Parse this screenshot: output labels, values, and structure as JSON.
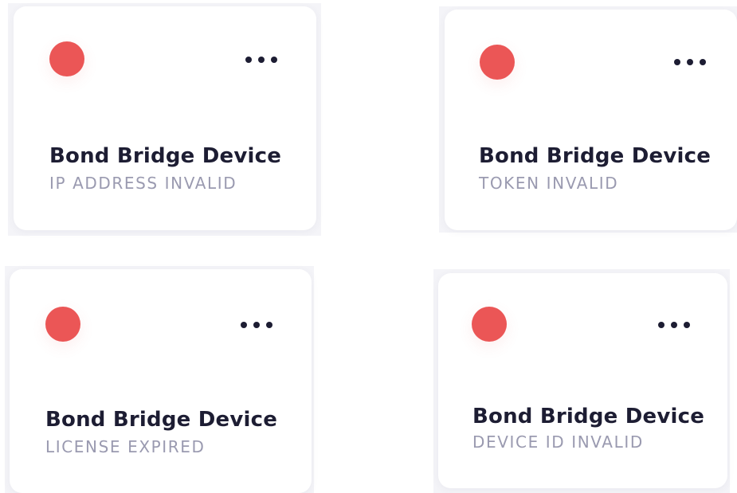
{
  "colors": {
    "status_dot": "#eb5656",
    "title_text": "#1d1d33",
    "status_text": "#9a9ab0",
    "menu_dots": "#1d1d33"
  },
  "icons": {
    "status_indicator": "status-dot-icon",
    "menu": "more-horizontal-icon"
  },
  "devices": [
    {
      "name": "Bond Bridge Device",
      "status": "IP ADDRESS INVALID"
    },
    {
      "name": "Bond Bridge Device",
      "status": "TOKEN INVALID"
    },
    {
      "name": "Bond Bridge Device",
      "status": "LICENSE EXPIRED"
    },
    {
      "name": "Bond Bridge Device",
      "status": "DEVICE ID INVALID"
    }
  ]
}
